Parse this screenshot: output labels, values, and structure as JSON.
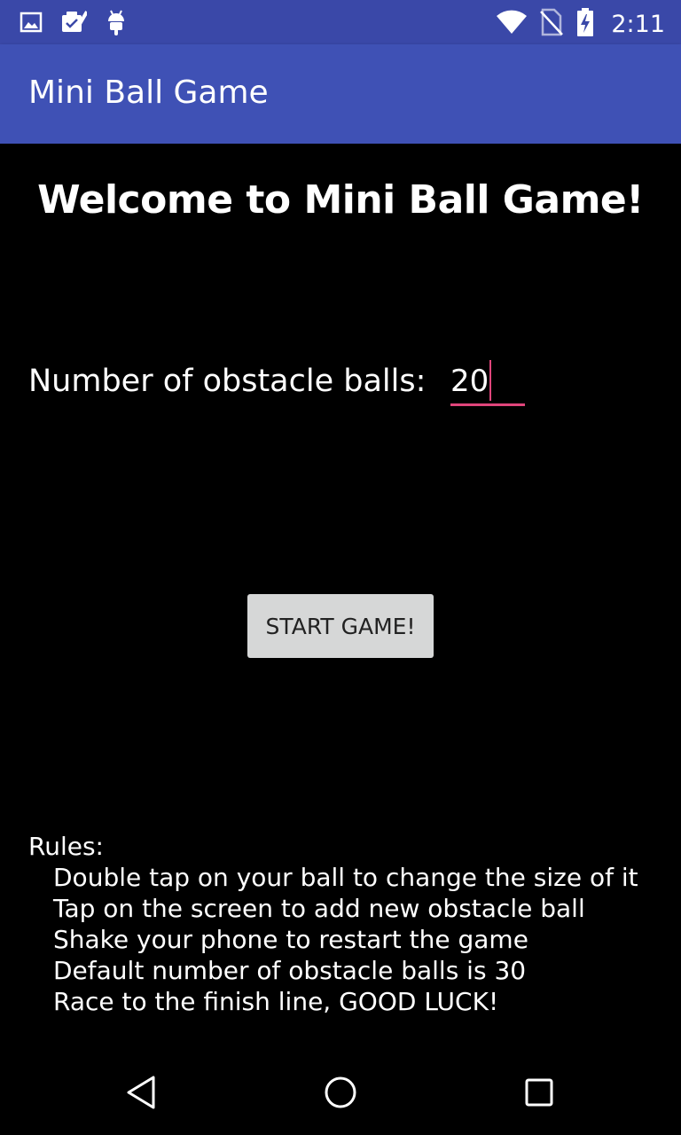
{
  "status_bar": {
    "time": "2:11",
    "left_icons": [
      "image-icon",
      "clipboard-check-icon",
      "android-icon"
    ],
    "right_icons": [
      "wifi-icon",
      "no-sim-icon",
      "battery-charging-icon"
    ]
  },
  "app_bar": {
    "title": "Mini Ball Game"
  },
  "main": {
    "welcome": "Welcome to Mini Ball Game!",
    "count_label": "Number of obstacle balls:",
    "count_value": "20",
    "start_label": "START GAME!"
  },
  "rules": {
    "heading": "Rules:",
    "items": [
      "Double tap on your ball to change the size of it",
      "Tap on the screen to add new obstacle ball",
      "Shake your phone to restart the game",
      "Default number of obstacle balls is 30",
      "Race to the finish line, GOOD LUCK!"
    ]
  },
  "nav_bar": {
    "icons": [
      "back-icon",
      "home-icon",
      "recents-icon"
    ]
  },
  "colors": {
    "status_bar": "#3a48a8",
    "app_bar": "#3f51b5",
    "accent": "#e0457b",
    "button": "#d6d7d7",
    "background": "#000000"
  }
}
